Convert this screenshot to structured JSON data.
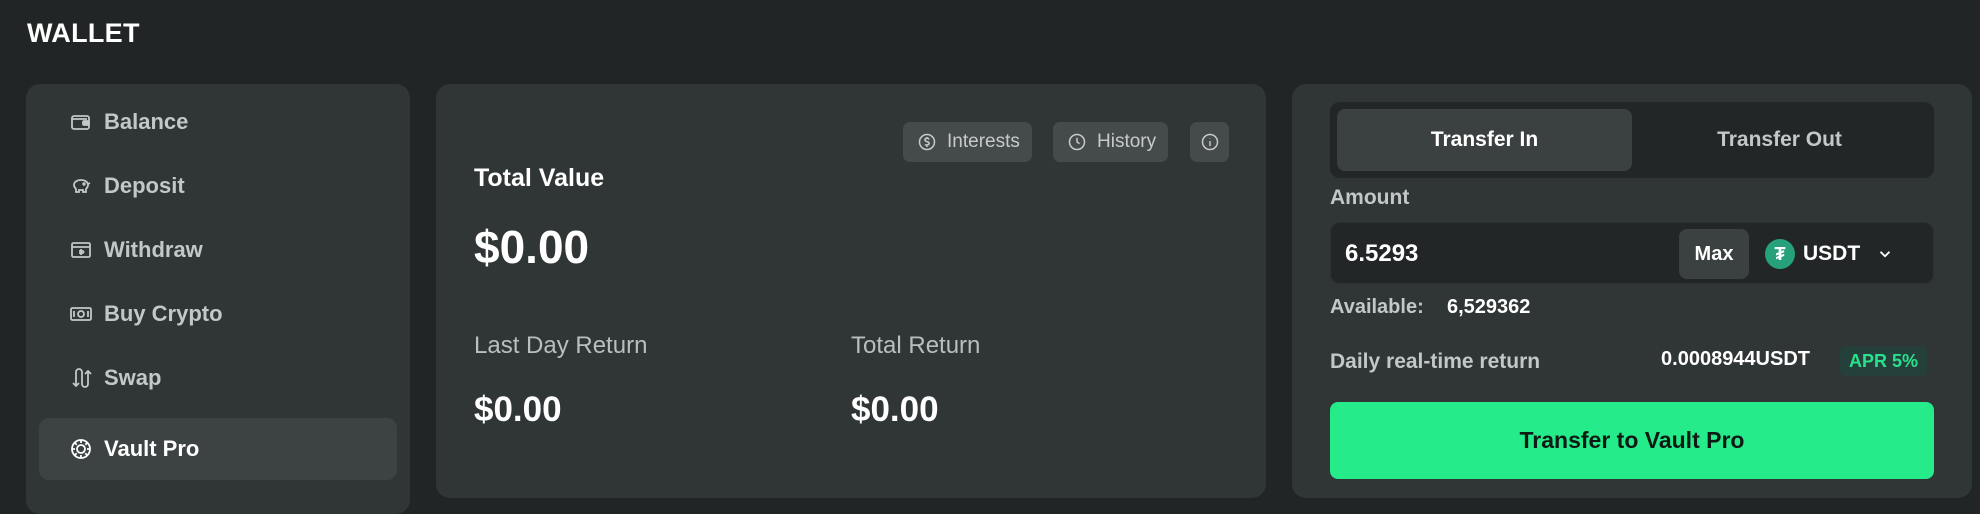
{
  "page": {
    "title": "WALLET"
  },
  "sidebar": {
    "items": [
      {
        "label": "Balance",
        "icon": "wallet-icon"
      },
      {
        "label": "Deposit",
        "icon": "piggy-bank-icon"
      },
      {
        "label": "Withdraw",
        "icon": "withdraw-icon"
      },
      {
        "label": "Buy Crypto",
        "icon": "cash-icon"
      },
      {
        "label": "Swap",
        "icon": "swap-icon"
      },
      {
        "label": "Vault Pro",
        "icon": "vault-icon",
        "active": true
      }
    ]
  },
  "summary": {
    "interests_label": "Interests",
    "history_label": "History",
    "total_value_label": "Total Value",
    "total_value": "$0.00",
    "last_day_return_label": "Last Day Return",
    "last_day_return": "$0.00",
    "total_return_label": "Total Return",
    "total_return": "$0.00"
  },
  "transfer": {
    "tabs": [
      {
        "label": "Transfer In",
        "active": true
      },
      {
        "label": "Transfer Out",
        "active": false
      }
    ],
    "amount_label": "Amount",
    "amount_value": "6.5293",
    "max_label": "Max",
    "coin": "USDT",
    "coin_glyph": "₮",
    "available_label": "Available:",
    "available_value": "6,529362",
    "daily_label": "Daily real-time return",
    "daily_value": "0.0008944USDT",
    "apr_label": "APR 5%",
    "cta_label": "Transfer to Vault Pro"
  },
  "colors": {
    "background": "#222525",
    "panel": "#303535",
    "accent": "#26eb8b",
    "apr_text": "#27e28c",
    "usdt": "#26a17b"
  }
}
